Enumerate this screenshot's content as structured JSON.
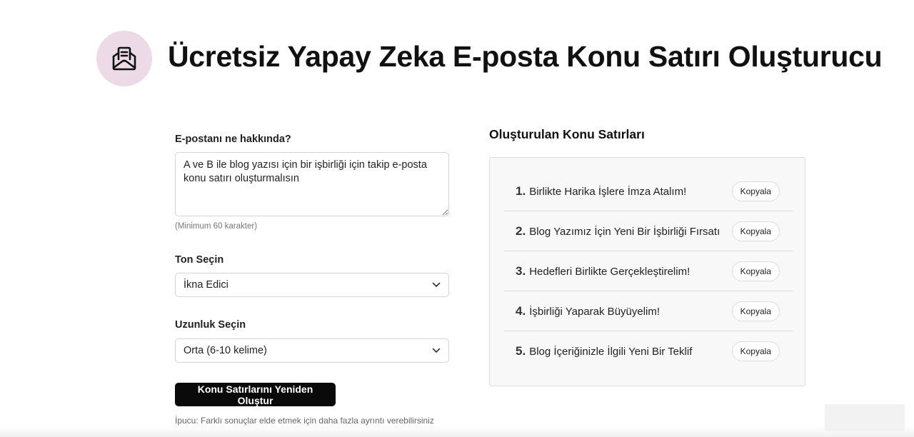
{
  "header": {
    "title": "Ücretsiz Yapay Zeka E-posta Konu Satırı Oluşturucu",
    "icon": "mail-open-icon",
    "icon_bg_color": "#ecdbe6"
  },
  "form": {
    "topic_label": "E-postanı ne hakkında?",
    "topic_value": "A ve B ile blog yazısı için bir işbirliği için takip e-posta konu satırı oluşturmalısın",
    "topic_hint": "(Minimum 60 karakter)",
    "tone_label": "Ton Seçin",
    "tone_value": "İkna Edici",
    "length_label": "Uzunluk Seçin",
    "length_value": "Orta (6-10 kelime)",
    "regenerate_label": "Konu Satırlarını Yeniden Oluştur",
    "tip": "İpucu: Farklı sonuçlar elde etmek için daha fazla ayrıntı verebilirsiniz"
  },
  "results": {
    "title": "Oluşturulan Konu Satırları",
    "copy_label": "Kopyala",
    "items": [
      {
        "num": "1.",
        "text": "Birlikte Harika İşlere İmza Atalım!"
      },
      {
        "num": "2.",
        "text": "Blog Yazımız İçin Yeni Bir İşbirliği Fırsatı"
      },
      {
        "num": "3.",
        "text": "Hedefleri Birlikte Gerçekleştirelim!"
      },
      {
        "num": "4.",
        "text": "İşbirliği Yaparak Büyüyelim!"
      },
      {
        "num": "5.",
        "text": "Blog İçeriğinizle İlgili Yeni Bir Teklif"
      }
    ]
  },
  "colors": {
    "accent_button": "#0a0a0a",
    "panel_bg": "#f8f8f8"
  }
}
